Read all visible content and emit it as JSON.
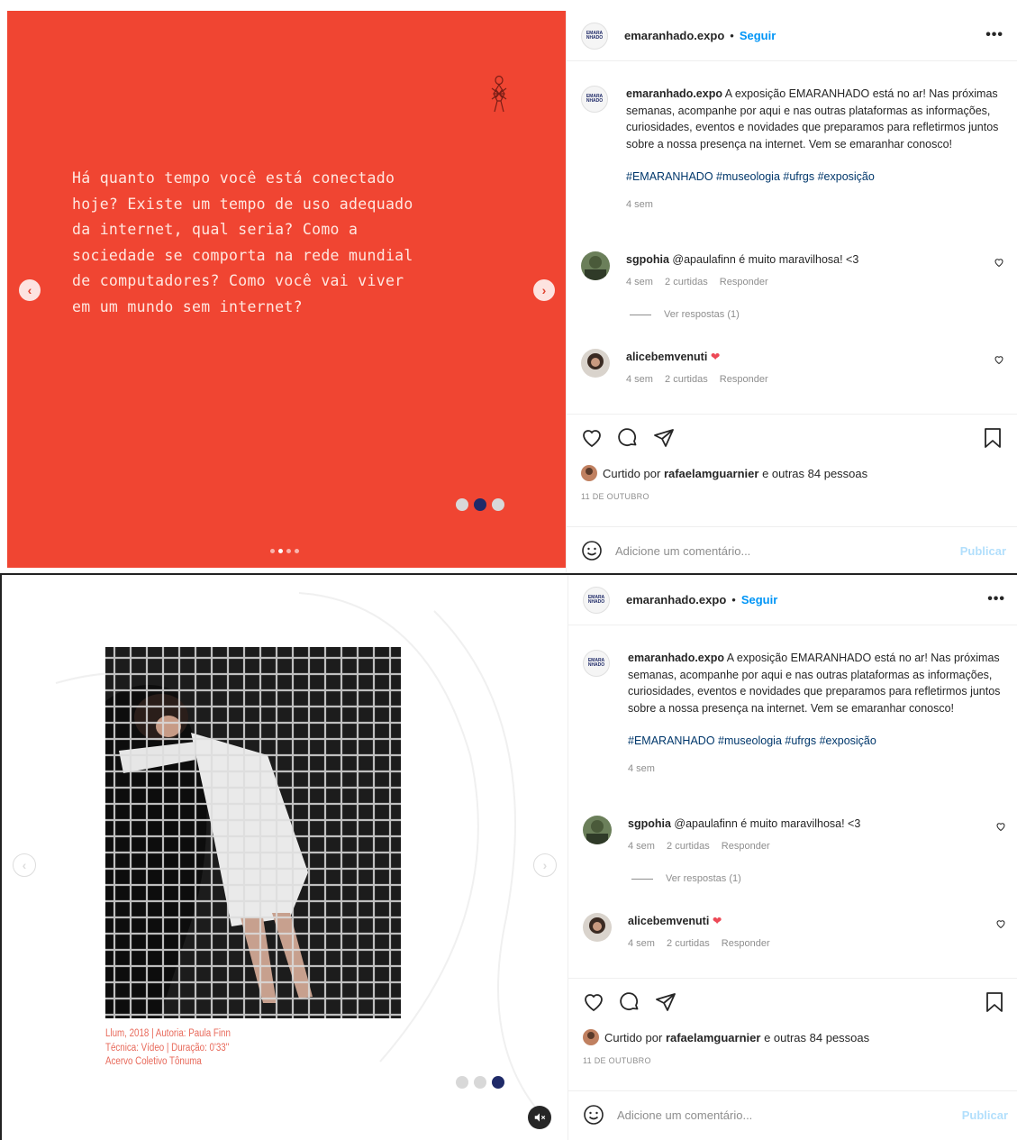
{
  "post": {
    "username": "emaranhado.expo",
    "separator": "•",
    "follow_label": "Seguir",
    "more_label": "•••",
    "avatar_text": "EMARA NHADO",
    "caption_text": "A exposição EMARANHADO está no ar! Nas próximas semanas, acompanhe por aqui e nas outras plataformas as informações, curiosidades, eventos e novidades que preparamos para refletirmos juntos sobre a nossa presença na internet. Vem se emaranhar conosco!",
    "hashtags": "#EMARANHADO #museologia #ufrgs #exposição",
    "caption_time": "4 sem",
    "comments": [
      {
        "user": "sgpohia",
        "text": "@apaulafinn é muito maravilhosa! <3",
        "time": "4 sem",
        "likes": "2 curtidas",
        "reply": "Responder",
        "view_replies": "Ver respostas (1)"
      },
      {
        "user": "alicebemvenuti",
        "text": "❤",
        "time": "4 sem",
        "likes": "2 curtidas",
        "reply": "Responder"
      }
    ],
    "liked_by_prefix": "Curtido por",
    "liked_by_user": "rafaelamguarnier",
    "liked_by_suffix": "e outras 84 pessoas",
    "date": "11 DE OUTUBRO",
    "comment_placeholder": "Adicione um comentário...",
    "publish_label": "Publicar"
  },
  "slide1": {
    "text": "Há quanto tempo você está conectado hoje? Existe um tempo de uso adequado da internet, qual seria?  Como a sociedade se comporta na rede mundial de computadores? Como você vai viver em um mundo sem internet?",
    "active_dot": 2,
    "total_dots": 3
  },
  "slide2": {
    "caption_line1": "Llum, 2018 | Autoria: Paula Finn",
    "caption_line2": "Técnica: Vídeo | Duração: 0'33\"",
    "caption_line3": "Acervo Coletivo Tônuma",
    "active_dot": 3,
    "total_dots": 3
  },
  "colors": {
    "slide_bg": "#f04532",
    "link_blue": "#0095f6",
    "hashtag": "#00376b",
    "active_dot": "#1f2a68",
    "caption_red": "#e8695a"
  }
}
